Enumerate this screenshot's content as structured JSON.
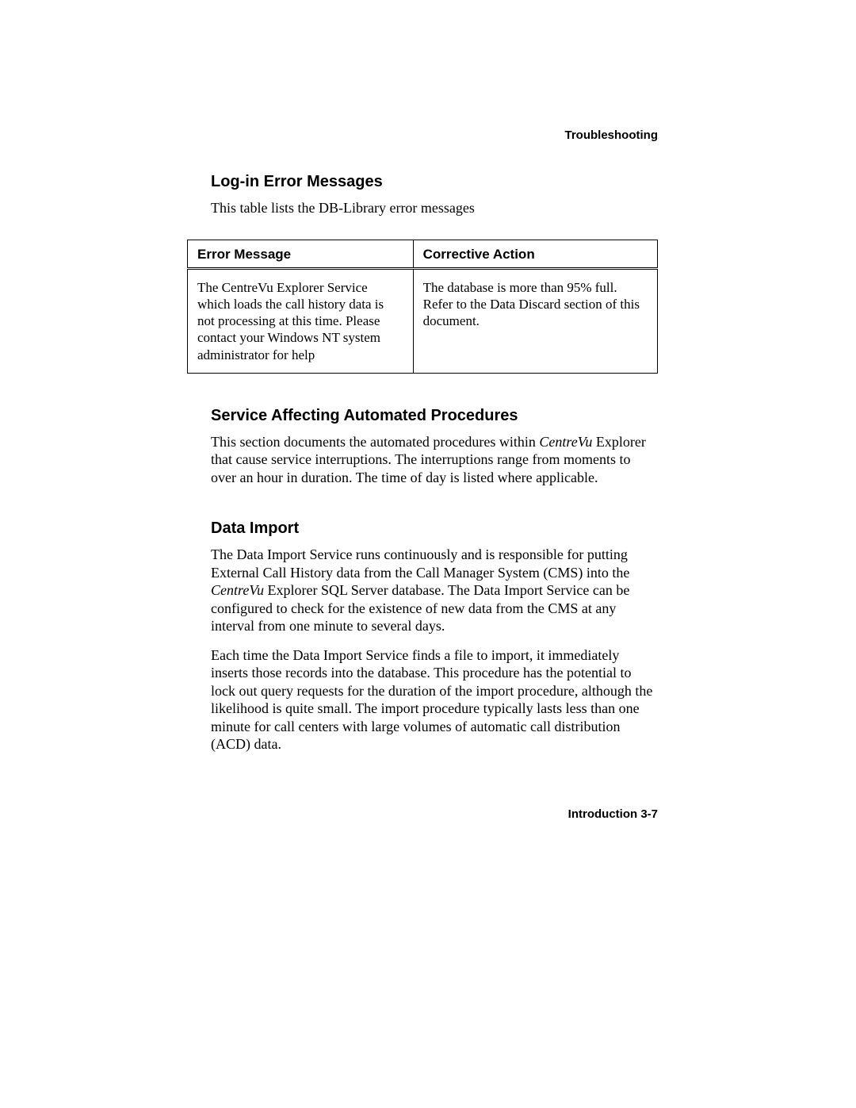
{
  "header": {
    "running_head": "Troubleshooting"
  },
  "sections": {
    "login_errors": {
      "heading": "Log-in Error Messages",
      "intro": "This table lists the DB-Library error messages",
      "table": {
        "headers": {
          "col1": "Error Message",
          "col2": "Corrective Action"
        },
        "rows": [
          {
            "error": "The CentreVu Explorer Service which loads the call history data is not processing at this time. Please contact your Windows NT system administrator for help",
            "action": "The database is more than 95% full. Refer to the Data Discard section of this document."
          }
        ]
      }
    },
    "service_affecting": {
      "heading": "Service Affecting Automated Procedures",
      "para1_pre": "This section documents the automated procedures within ",
      "para1_italic": "CentreVu",
      "para1_post": " Explorer that cause service interruptions. The interruptions range from moments to over an hour in duration. The time of day is listed where applicable."
    },
    "data_import": {
      "heading": "Data Import",
      "para1_pre": "The Data Import Service runs continuously and is responsible for putting External Call History data from the Call Manager System (CMS) into the ",
      "para1_italic": "CentreVu",
      "para1_post": " Explorer SQL Server database. The Data Import Service can be configured to check for the existence of new data from the CMS at any interval from one minute to several days.",
      "para2": "Each time the Data Import Service finds a file to import, it immediately inserts those records into the database. This procedure has the potential to lock out query requests for the duration of the import procedure, although the likelihood is quite small. The import procedure typically lasts less than one minute for call centers with large volumes of automatic call distribution (ACD) data."
    }
  },
  "footer": {
    "page_label": "Introduction  3-7"
  }
}
